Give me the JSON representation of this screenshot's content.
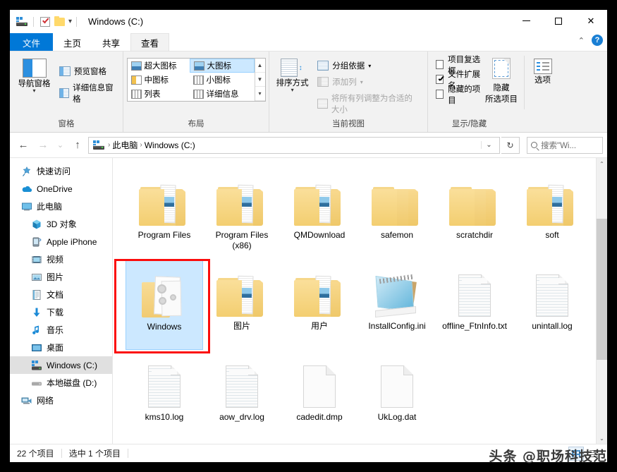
{
  "window": {
    "title": "Windows (C:)",
    "quick_access": [
      "drive-icon",
      "checklist-icon",
      "folder-icon"
    ],
    "controls": {
      "minimize": "—",
      "maximize": "□",
      "close": "✕"
    }
  },
  "tabs": [
    {
      "label": "文件",
      "state": "file"
    },
    {
      "label": "主页",
      "state": "normal"
    },
    {
      "label": "共享",
      "state": "normal"
    },
    {
      "label": "查看",
      "state": "active"
    }
  ],
  "help": {
    "collapse": "⌃",
    "help_label": "?"
  },
  "ribbon": {
    "groups": [
      {
        "name": "窗格",
        "big_button": {
          "label": "导航窗格",
          "has_dropdown": true
        },
        "small_buttons": [
          {
            "label": "预览窗格",
            "disabled": false
          },
          {
            "label": "详细信息窗格",
            "disabled": false
          }
        ]
      },
      {
        "name": "布局",
        "gallery": [
          {
            "label": "超大图标",
            "selected": false
          },
          {
            "label": "大图标",
            "selected": true
          },
          {
            "label": "中图标",
            "selected": false
          },
          {
            "label": "小图标",
            "selected": false
          },
          {
            "label": "列表",
            "selected": false
          },
          {
            "label": "详细信息",
            "selected": false
          }
        ],
        "scroll": [
          "▲",
          "▼",
          "▾"
        ]
      },
      {
        "name": "当前视图",
        "big_button": {
          "label": "排序方式",
          "has_dropdown": true
        },
        "small_buttons": [
          {
            "label": "分组依据",
            "disabled": false,
            "dropdown": "▾"
          },
          {
            "label": "添加列",
            "disabled": true,
            "dropdown": "▾"
          },
          {
            "label": "将所有列调整为合适的大小",
            "disabled": true
          }
        ]
      },
      {
        "name": "显示/隐藏",
        "checkboxes": [
          {
            "label": "项目复选框",
            "checked": false
          },
          {
            "label": "文件扩展名",
            "checked": true
          },
          {
            "label": "隐藏的项目",
            "checked": false
          }
        ],
        "hide_button": {
          "line1": "隐藏",
          "line2": "所选项目"
        },
        "options_button": {
          "label": "选项"
        }
      }
    ]
  },
  "addressbar": {
    "back": "←",
    "forward": "→",
    "recent": "⌄",
    "up": "↑",
    "breadcrumbs": [
      "此电脑",
      "Windows (C:)"
    ],
    "separator": "›",
    "dropdown": "⌄",
    "refresh": "↻",
    "search_placeholder": "搜索\"Wi..."
  },
  "sidebar": {
    "items": [
      {
        "label": "快速访问",
        "icon": "star-pin-icon",
        "level": 1,
        "selected": false
      },
      {
        "label": "OneDrive",
        "icon": "cloud-icon",
        "level": 1,
        "selected": false
      },
      {
        "label": "此电脑",
        "icon": "monitor-icon",
        "level": 1,
        "selected": false
      },
      {
        "label": "3D 对象",
        "icon": "cube-icon",
        "level": 2,
        "selected": false
      },
      {
        "label": "Apple iPhone",
        "icon": "phone-icon",
        "level": 2,
        "selected": false
      },
      {
        "label": "视频",
        "icon": "video-icon",
        "level": 2,
        "selected": false
      },
      {
        "label": "图片",
        "icon": "picture-icon",
        "level": 2,
        "selected": false
      },
      {
        "label": "文档",
        "icon": "document-icon",
        "level": 2,
        "selected": false
      },
      {
        "label": "下载",
        "icon": "download-arrow-icon",
        "level": 2,
        "selected": false
      },
      {
        "label": "音乐",
        "icon": "music-note-icon",
        "level": 2,
        "selected": false
      },
      {
        "label": "桌面",
        "icon": "desktop-icon",
        "level": 2,
        "selected": false
      },
      {
        "label": "Windows (C:)",
        "icon": "drive-icon",
        "level": 2,
        "selected": true
      },
      {
        "label": "本地磁盘 (D:)",
        "icon": "drive-icon",
        "level": 2,
        "selected": false
      },
      {
        "label": "网络",
        "icon": "network-icon",
        "level": 1,
        "selected": false
      }
    ]
  },
  "files": {
    "rows": [
      [
        {
          "name": "Program Files",
          "type": "folder-docs",
          "selected": false
        },
        {
          "name": "Program Files (x86)",
          "type": "folder-docs",
          "selected": false
        },
        {
          "name": "QMDownload",
          "type": "folder-docs",
          "selected": false
        },
        {
          "name": "safemon",
          "type": "folder-plain",
          "selected": false
        },
        {
          "name": "scratchdir",
          "type": "folder-plain",
          "selected": false
        },
        {
          "name": "soft",
          "type": "folder-docs",
          "selected": false
        }
      ],
      [
        {
          "name": "Windows",
          "type": "folder-windows",
          "selected": true
        },
        {
          "name": "图片",
          "type": "folder-docs",
          "selected": false
        },
        {
          "name": "用户",
          "type": "folder-docs",
          "selected": false
        },
        {
          "name": "InstallConfig.ini",
          "type": "file-notepad",
          "selected": false
        },
        {
          "name": "offline_FtnInfo.txt",
          "type": "file-lined",
          "selected": false
        },
        {
          "name": "unintall.log",
          "type": "file-lined",
          "selected": false
        }
      ],
      [
        {
          "name": "kms10.log",
          "type": "file-lined",
          "selected": false
        },
        {
          "name": "aow_drv.log",
          "type": "file-lined",
          "selected": false
        },
        {
          "name": "cadedit.dmp",
          "type": "file-blank",
          "selected": false
        },
        {
          "name": "UkLog.dat",
          "type": "file-blank",
          "selected": false
        }
      ]
    ]
  },
  "statusbar": {
    "item_count": "22 个项目",
    "selection": "选中 1 个项目",
    "view_large_icons": "large-icons-view",
    "view_details": "details-view"
  },
  "watermark": "头条 @职场科技范",
  "colors": {
    "accent": "#0078d7",
    "selection": "#cce8ff",
    "annotation": "#fb0d0d",
    "folder": "#f3cf7c"
  }
}
